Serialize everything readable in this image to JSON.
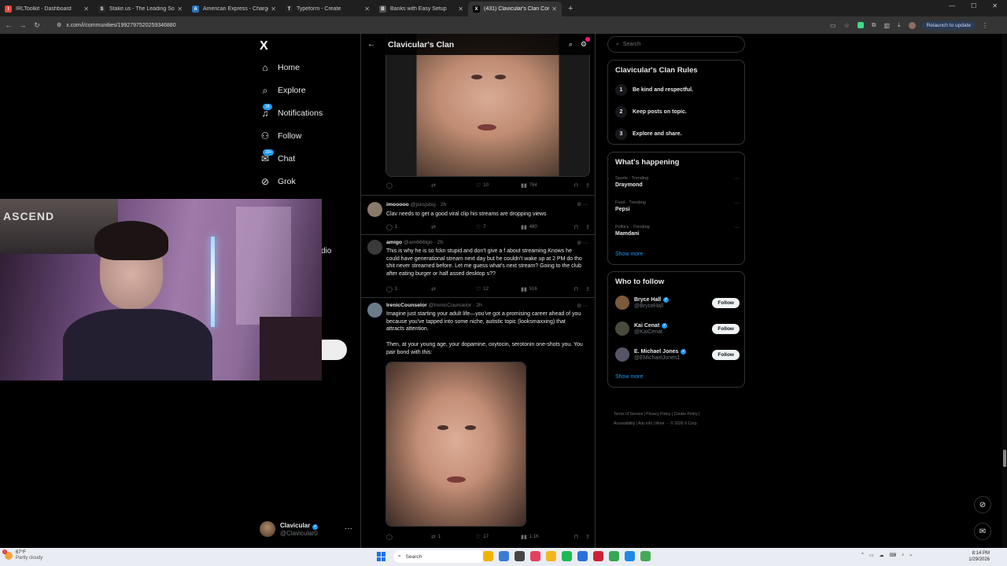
{
  "browser": {
    "tabs": [
      {
        "label": "IRLToolkit - Dashboard",
        "color": "#e8453c",
        "glyph": "I"
      },
      {
        "label": "Stake.us - The Leading Social C...",
        "color": "#2a2a2a",
        "glyph": "S"
      },
      {
        "label": "American Express - Charge Veri...",
        "color": "#2671b9",
        "glyph": "A"
      },
      {
        "label": "Typeform - Create",
        "color": "#262627",
        "glyph": "T"
      },
      {
        "label": "Banks with Easy Setup",
        "color": "#555555",
        "glyph": "B"
      },
      {
        "label": "(431) Clavicular's Clan Commu...",
        "color": "#000000",
        "glyph": "X"
      }
    ],
    "new_tab": "+",
    "window_controls": [
      "—",
      "☐",
      "✕"
    ],
    "url": "x.com/i/communities/1992797520259346880",
    "relaunch_label": "Relaunch to update"
  },
  "nav": {
    "logo": "X",
    "items": [
      {
        "label": "Home",
        "icon": "⌂"
      },
      {
        "label": "Explore",
        "icon": "⌕"
      },
      {
        "label": "Notifications",
        "icon": "♫",
        "badge": "18"
      },
      {
        "label": "Follow",
        "icon": "⚇"
      },
      {
        "label": "Chat",
        "icon": "✉",
        "badge": "20+"
      },
      {
        "label": "Grok",
        "icon": "⊘"
      }
    ],
    "account": {
      "name": "Clavicular",
      "handle": "@Clavicular0",
      "more": "···"
    }
  },
  "webcam": {
    "banner_text": "ASCEND",
    "behind_text": "dio"
  },
  "community": {
    "title": "Clavicular's Clan",
    "back_icon": "←",
    "search_icon": "⌕",
    "settings_icon": "⚙"
  },
  "posts": [
    {
      "id": "top",
      "actions": {
        "reply": "",
        "repost": "",
        "like": "10",
        "views": "764"
      }
    },
    {
      "id": "imooooo",
      "name": "imooooo",
      "handle": "@jsksjsbsj",
      "time": "· 2h",
      "text": "Clav needs to get a good viral clip his streams are dropping views",
      "avatar_color": "#8a7a6a",
      "actions": {
        "reply": "1",
        "repost": "",
        "like": "7",
        "views": "480"
      }
    },
    {
      "id": "amigo",
      "name": "amigo",
      "handle": "@am666lgo",
      "time": "· 2h",
      "text": "This is why he is so fckn stupid and don't give a f about streaming.Knows he could have generational stream next day but he couldn't wake up at 2 PM do tho shit never streamed before. Let me guess what's next stream? Going to the club after eating burger or half assed desktop s??",
      "avatar_color": "#3a3a3a",
      "actions": {
        "reply": "1",
        "repost": "",
        "like": "12",
        "views": "516"
      }
    },
    {
      "id": "irenic",
      "name": "IrenicCounselor",
      "handle": "@IrenicCounselor",
      "time": "· 2h",
      "text": "Imagine just starting your adult life—you've got a promising career ahead of you because you've tapped into some niche, autistic topic (looksmaxxing) that attracts attention.",
      "text2": "Then, at your young age, your dopamine, oxytocin, serotonin one-shots you. You pair bond with this:",
      "avatar_color": "#6b7b8c",
      "actions": {
        "reply": "",
        "repost": "1",
        "like": "17",
        "views": "1.1K"
      }
    }
  ],
  "sidebar": {
    "search_placeholder": "Search",
    "rules": {
      "title": "Clavicular's Clan Rules",
      "items": [
        {
          "num": "1",
          "label": "Be kind and respectful."
        },
        {
          "num": "2",
          "label": "Keep posts on topic."
        },
        {
          "num": "3",
          "label": "Explore and share."
        }
      ]
    },
    "happening": {
      "title": "What's happening",
      "trends": [
        {
          "category": "Sports · Trending",
          "name": "Draymond"
        },
        {
          "category": "Food · Trending",
          "name": "Pepsi"
        },
        {
          "category": "Politics · Trending",
          "name": "Mamdani"
        }
      ],
      "show_more": "Show more"
    },
    "who_to_follow": {
      "title": "Who to follow",
      "accounts": [
        {
          "name": "Bryce Hall",
          "handle": "@BryceHall",
          "button": "Follow",
          "avatar_color": "#7a5a3a"
        },
        {
          "name": "Kai Cenat",
          "handle": "@KaiCenat",
          "button": "Follow",
          "avatar_color": "#4a4a3a"
        },
        {
          "name": "E. Michael Jones",
          "handle": "@EMichaelJones1",
          "button": "Follow",
          "avatar_color": "#555566"
        }
      ],
      "show_more": "Show more"
    },
    "footer_line1": "Terms of Service  |  Privacy Policy  |  Cookie Policy  |",
    "footer_line2": "Accessibility  |  Ads info  |  More ···  © 2026 X Corp."
  },
  "floating": {
    "grok_icon": "⊘",
    "messages_icon": "✉"
  },
  "taskbar": {
    "weather_temp": "67°F",
    "weather_desc": "Partly cloudy",
    "weather_badge": "1",
    "search_label": "Search",
    "time": "8:14 PM",
    "date": "1/29/2026",
    "apps": [
      "#f0b400",
      "#3a7bd5",
      "#444444",
      "#e4405f",
      "#f2b71c",
      "#1db954",
      "#2a6fdb",
      "#cc2233",
      "#34a853",
      "#1e88e5",
      "#44aa55"
    ],
    "tray_icons": [
      "^",
      "▭",
      "☁",
      "⌨",
      "♪",
      "⌁"
    ]
  }
}
